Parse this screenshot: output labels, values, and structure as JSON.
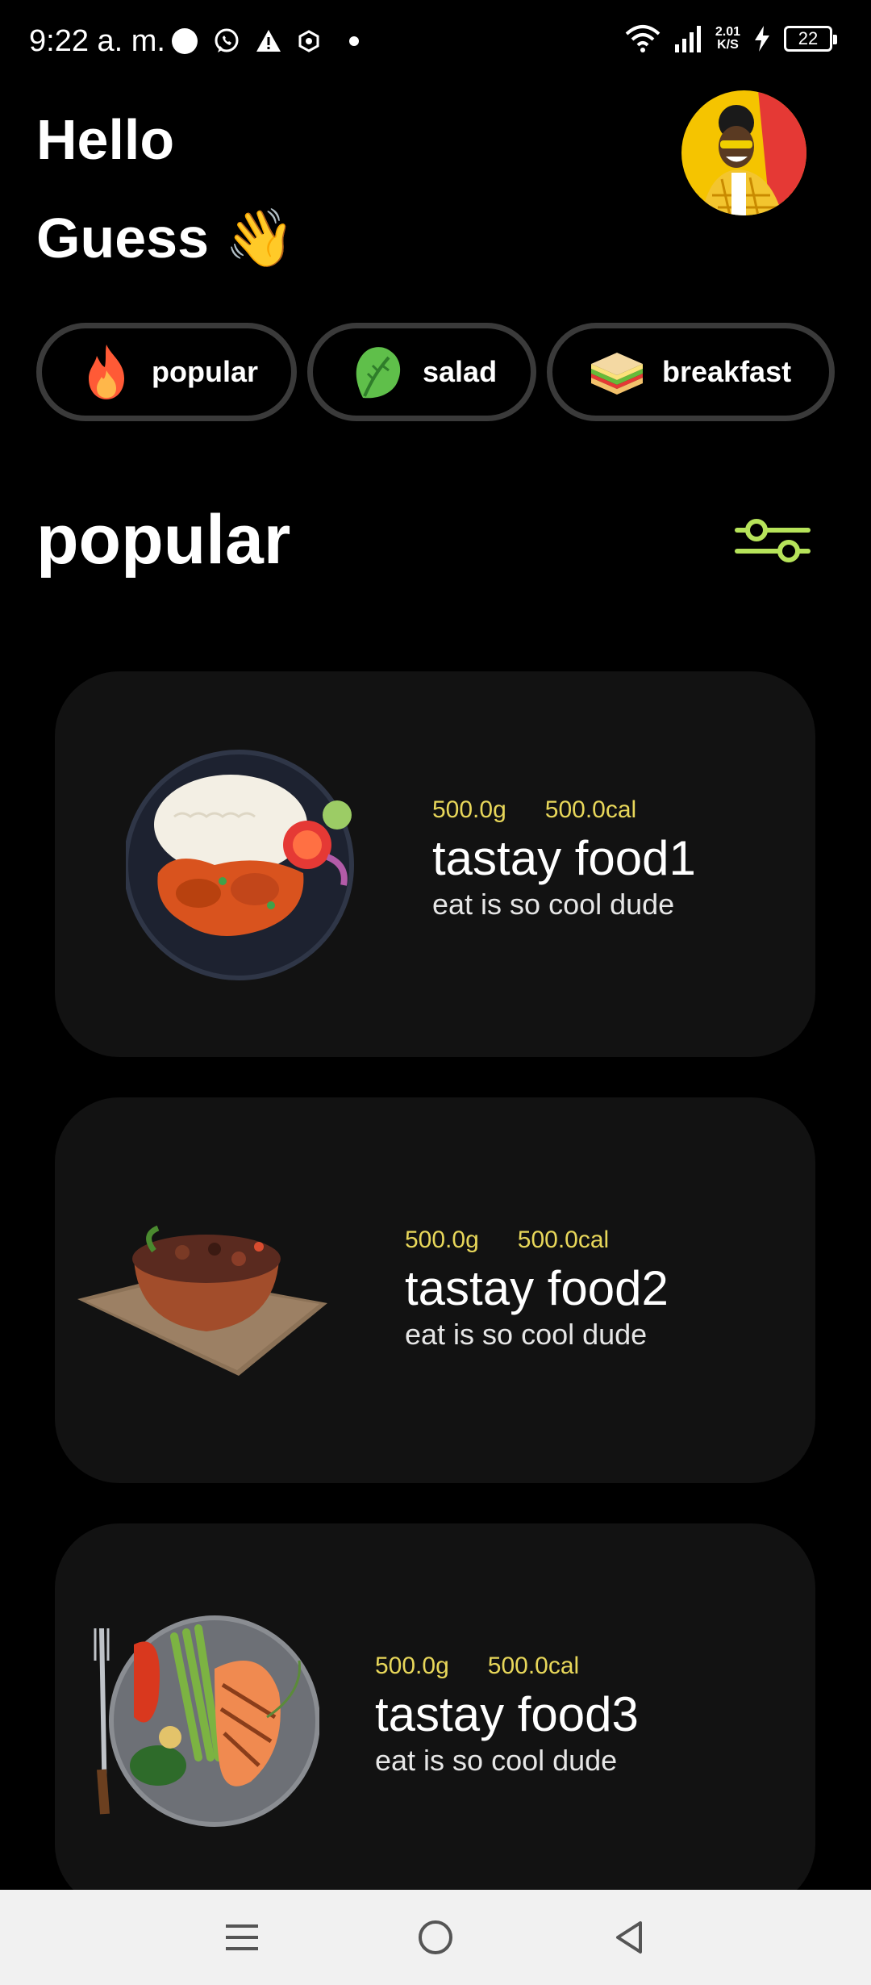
{
  "status_bar": {
    "time": "9:22 a. m.",
    "net_speed_value": "2.01",
    "net_speed_unit": "K/S",
    "battery": "22"
  },
  "greeting": {
    "line1": "Hello",
    "line2": "Guess 👋"
  },
  "categories": [
    {
      "label": "popular",
      "icon": "fire-icon"
    },
    {
      "label": "salad",
      "icon": "lettuce-icon"
    },
    {
      "label": "breakfast",
      "icon": "sandwich-icon"
    }
  ],
  "section": {
    "title": "popular",
    "filter_icon": "sliders-icon"
  },
  "foods": [
    {
      "weight": "500.0g",
      "calories": "500.0cal",
      "name": "tastay food1",
      "description": "eat is so cool dude"
    },
    {
      "weight": "500.0g",
      "calories": "500.0cal",
      "name": "tastay food2",
      "description": "eat is so cool dude"
    },
    {
      "weight": "500.0g",
      "calories": "500.0cal",
      "name": "tastay food3",
      "description": "eat is so cool dude"
    }
  ],
  "colors": {
    "background": "#000000",
    "card": "#121212",
    "chip_border": "#3a3a3a",
    "stat_text": "#e8d75a",
    "filter_accent": "#b6e35a"
  }
}
